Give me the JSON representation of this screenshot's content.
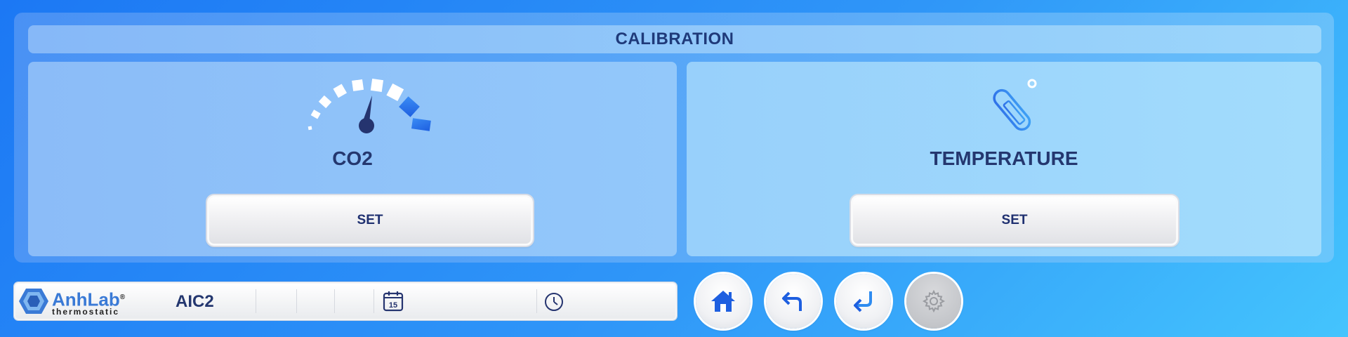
{
  "header": {
    "title": "CALIBRATION"
  },
  "cards": [
    {
      "label": "CO2",
      "icon": "co2-gauge-icon",
      "button_label": "SET"
    },
    {
      "label": "TEMPERATURE",
      "icon": "thermometer-icon",
      "button_label": "SET"
    }
  ],
  "status_bar": {
    "brand": "AnhLab",
    "brand_mark": "®",
    "brand_sub": "thermostatic",
    "device_name": "AIC2",
    "date_icon": "calendar-icon",
    "date_icon_day": "15",
    "time_icon": "clock-icon",
    "date_value": "",
    "time_value": ""
  },
  "nav": [
    {
      "name": "home",
      "icon": "home-icon",
      "enabled": true
    },
    {
      "name": "back",
      "icon": "back-arrow-icon",
      "enabled": true
    },
    {
      "name": "enter",
      "icon": "enter-arrow-icon",
      "enabled": true
    },
    {
      "name": "settings",
      "icon": "gear-icon",
      "enabled": false
    }
  ],
  "colors": {
    "accent": "#1f3a7a",
    "background_start": "#1c78f4",
    "background_end": "#44c4fd",
    "icon_blue": "#2f6fe8"
  }
}
